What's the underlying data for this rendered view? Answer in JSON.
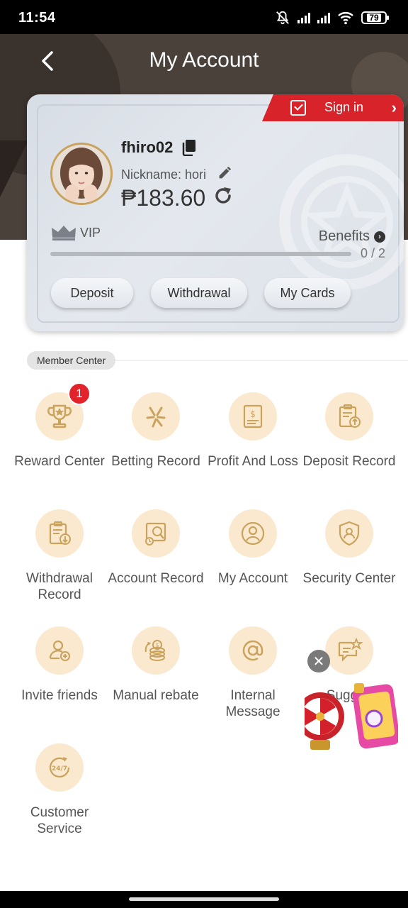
{
  "status_bar": {
    "time": "11:54",
    "battery": "79"
  },
  "header": {
    "title": "My Account"
  },
  "account": {
    "sign_in_label": "Sign in",
    "username": "fhiro02",
    "nickname": "Nickname: hori",
    "balance": "₱183.60",
    "vip_label": "VIP",
    "benefits_label": "Benefits",
    "progress_text": "0 / 2",
    "progress_fraction": 0,
    "buttons": {
      "deposit": "Deposit",
      "withdrawal": "Withdrawal",
      "my_cards": "My Cards"
    }
  },
  "member_center": {
    "title": "Member Center",
    "items": [
      {
        "label": "Reward Center",
        "icon": "trophy-icon",
        "badge": "1"
      },
      {
        "label": "Betting Record",
        "icon": "betting-icon"
      },
      {
        "label": "Profit And Loss",
        "icon": "document-icon"
      },
      {
        "label": "Deposit Record",
        "icon": "deposit-record-icon"
      },
      {
        "label": "Withdrawal Record",
        "icon": "withdrawal-record-icon"
      },
      {
        "label": "Account Record",
        "icon": "account-record-icon"
      },
      {
        "label": "My Account",
        "icon": "user-icon"
      },
      {
        "label": "Security Center",
        "icon": "shield-icon"
      },
      {
        "label": "Invite friends",
        "icon": "invite-icon"
      },
      {
        "label": "Manual rebate",
        "icon": "coins-icon"
      },
      {
        "label": "Internal Message",
        "icon": "at-icon"
      },
      {
        "label": "Sugges",
        "icon": "suggestion-icon"
      },
      {
        "label": "Customer Service",
        "icon": "24-7-icon"
      }
    ]
  },
  "colors": {
    "accent": "#c9a25c",
    "sign_in": "#d8232a",
    "icon_bg": "#fbe9cf",
    "header": "#4a413b"
  }
}
